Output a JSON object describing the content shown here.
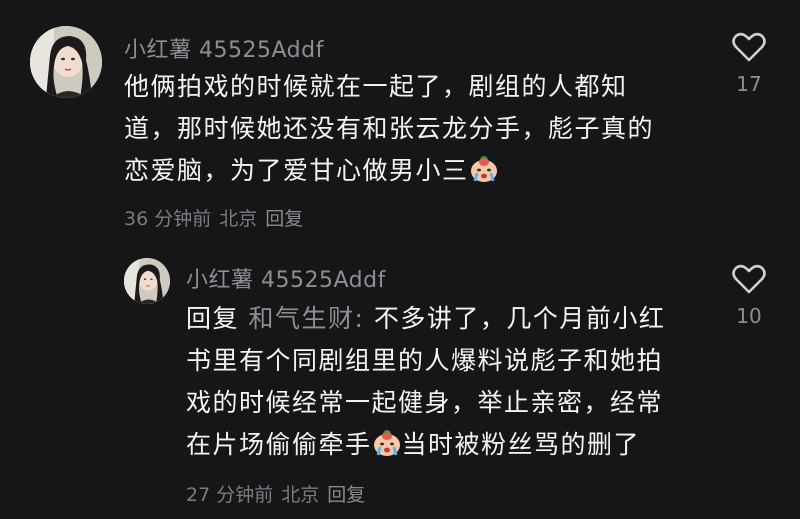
{
  "comments": [
    {
      "username": "小红薯 45525Addf",
      "lines": [
        "他俩拍戏的时候就在一起了，剧组的人都知",
        "道，那时候她还没有和张云龙分手，彪子真的",
        "恋爱脑，为了爱甘心做男小三"
      ],
      "emoji": "crying-face-icon",
      "time": "36 分钟前",
      "location": "北京",
      "reply_label": "回复",
      "likes": "17"
    },
    {
      "username": "小红薯 45525Addf",
      "reply_prefix": "回复",
      "reply_target": "和气生财:",
      "lines": [
        "不多讲了，几个月前小红",
        "书里有个同剧组里的人爆料说彪子和她拍",
        "戏的时候经常一起健身，举止亲密，经常",
        "在片场偷偷牵手"
      ],
      "line4_tail": "当时被粉丝骂的删了",
      "emoji": "crying-face-icon",
      "time": "27 分钟前",
      "location": "北京",
      "reply_label": "回复",
      "likes": "10"
    }
  ],
  "colors": {
    "background": "#161618",
    "text": "#f4f4f4",
    "secondary": "#8e8e93"
  }
}
